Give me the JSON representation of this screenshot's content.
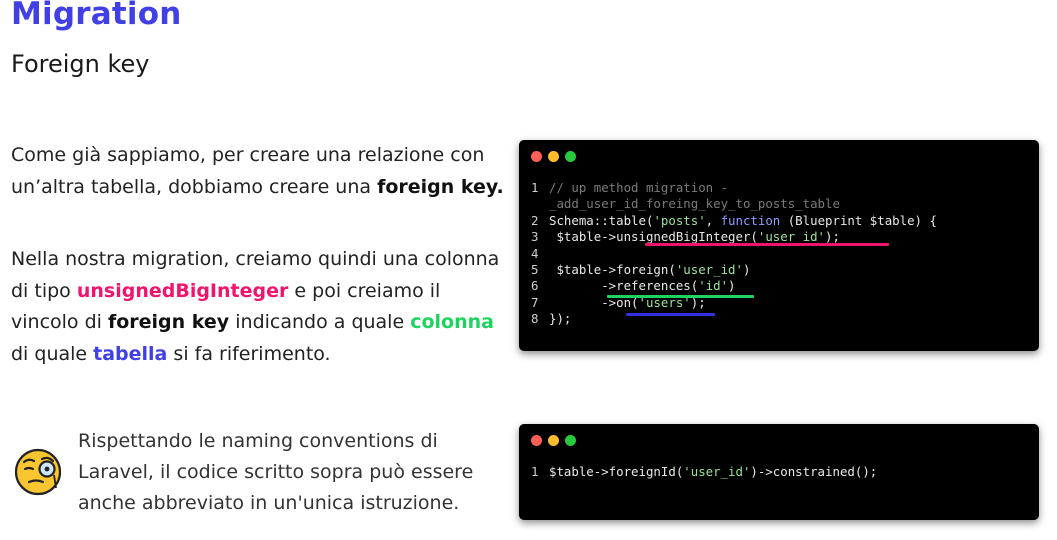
{
  "header": {
    "title": "Migration",
    "subtitle": "Foreign key"
  },
  "intro": {
    "text_before": "Come già sappiamo, per creare una relazione con un’altra tabella, dobbiamo creare una ",
    "strong": "foreign key.",
    "text_after": ""
  },
  "explanation": {
    "t1": "Nella nostra migration, creiamo quindi una colonna di tipo ",
    "k1": "unsignedBigInteger",
    "t2": " e poi creiamo il vincolo di ",
    "k2": "foreign key",
    "t3": " indicando a quale ",
    "k3": "colonna",
    "t4": " di quale ",
    "k4": "tabella",
    "t5": " si fa riferimento."
  },
  "tip": {
    "icon": "monocle-face-icon",
    "text": "Rispettando le naming conventions di Laravel, il codice scritto sopra può essere anche abbreviato in un'unica istruzione."
  },
  "code_block_1": {
    "lines": [
      {
        "n": "1",
        "parts": [
          {
            "c": "cm",
            "t": "// up method migration -"
          }
        ]
      },
      {
        "n": "",
        "parts": [
          {
            "c": "cm",
            "t": "_add_user_id_foreing_key_to_posts_table"
          }
        ]
      },
      {
        "n": "2",
        "parts": [
          {
            "c": "",
            "t": "Schema::table("
          },
          {
            "c": "st",
            "t": "'posts'"
          },
          {
            "c": "",
            "t": ", "
          },
          {
            "c": "fn-kw",
            "t": "function"
          },
          {
            "c": "",
            "t": " (Blueprint $table) {"
          }
        ]
      },
      {
        "n": "3",
        "parts": [
          {
            "c": "",
            "t": " $table->unsignedBigInteger("
          },
          {
            "c": "st",
            "t": "'user_id'"
          },
          {
            "c": "",
            "t": ");"
          }
        ]
      },
      {
        "n": "4",
        "parts": [
          {
            "c": "",
            "t": ""
          }
        ]
      },
      {
        "n": "5",
        "parts": [
          {
            "c": "",
            "t": " $table->foreign("
          },
          {
            "c": "st",
            "t": "'user_id'"
          },
          {
            "c": "",
            "t": ")"
          }
        ]
      },
      {
        "n": "6",
        "parts": [
          {
            "c": "",
            "t": "       ->references("
          },
          {
            "c": "st",
            "t": "'id'"
          },
          {
            "c": "",
            "t": ")"
          }
        ]
      },
      {
        "n": "7",
        "parts": [
          {
            "c": "",
            "t": "       ->on("
          },
          {
            "c": "st",
            "t": "'users'"
          },
          {
            "c": "",
            "t": ");"
          }
        ]
      },
      {
        "n": "8",
        "parts": [
          {
            "c": "",
            "t": "});"
          }
        ]
      }
    ]
  },
  "code_block_2": {
    "lines": [
      {
        "n": "1",
        "parts": [
          {
            "c": "",
            "t": "$table->foreignId("
          },
          {
            "c": "st",
            "t": "'user_id'"
          },
          {
            "c": "",
            "t": ")->constrained();"
          }
        ]
      }
    ]
  },
  "colors": {
    "title": "#4040e6",
    "pink": "#f0146e",
    "green": "#1ed45e",
    "blue": "#4040e6",
    "code_bg": "#000000"
  }
}
